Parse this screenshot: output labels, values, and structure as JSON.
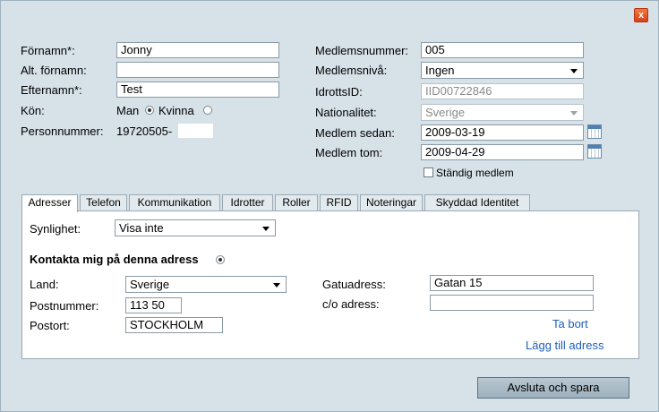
{
  "close_label": "x",
  "left_form": {
    "fornamn_label": "Förnamn*:",
    "fornamn_value": "Jonny",
    "alt_fornamn_label": "Alt. förnamn:",
    "alt_fornamn_value": "",
    "efternamn_label": "Efternamn*:",
    "efternamn_value": "Test",
    "kon_label": "Kön:",
    "kon_man": "Man",
    "kon_kvinna": "Kvinna",
    "personnummer_label": "Personnummer:",
    "personnummer_value": "19720505-"
  },
  "right_form": {
    "medlemsnummer_label": "Medlemsnummer:",
    "medlemsnummer_value": "005",
    "medlemsniva_label": "Medlemsnivå:",
    "medlemsniva_value": "Ingen",
    "idrottsid_label": "IdrottsID:",
    "idrottsid_value": "IID00722846",
    "nationalitet_label": "Nationalitet:",
    "nationalitet_value": "Sverige",
    "medlem_sedan_label": "Medlem sedan:",
    "medlem_sedan_value": "2009-03-19",
    "medlem_tom_label": "Medlem tom:",
    "medlem_tom_value": "2009-04-29",
    "standig_label": "Ständig medlem"
  },
  "tabs": [
    {
      "label": "Adresser"
    },
    {
      "label": "Telefon"
    },
    {
      "label": "Kommunikation"
    },
    {
      "label": "Idrotter"
    },
    {
      "label": "Roller"
    },
    {
      "label": "RFID"
    },
    {
      "label": "Noteringar"
    },
    {
      "label": "Skyddad Identitet"
    }
  ],
  "address": {
    "synlighet_label": "Synlighet:",
    "synlighet_value": "Visa inte",
    "kontakta_label": "Kontakta mig på denna adress",
    "land_label": "Land:",
    "land_value": "Sverige",
    "postnummer_label": "Postnummer:",
    "postnummer_value": "113 50",
    "postort_label": "Postort:",
    "postort_value": "STOCKHOLM",
    "gatuadress_label": "Gatuadress:",
    "gatuadress_value": "Gatan 15",
    "co_label": "c/o adress:",
    "co_value": "",
    "ta_bort": "Ta bort",
    "lagg_till": "Lägg till adress"
  },
  "save_label": "Avsluta och spara",
  "colors": {
    "accent_link": "#1d5fb8",
    "close": "#e0501f"
  }
}
